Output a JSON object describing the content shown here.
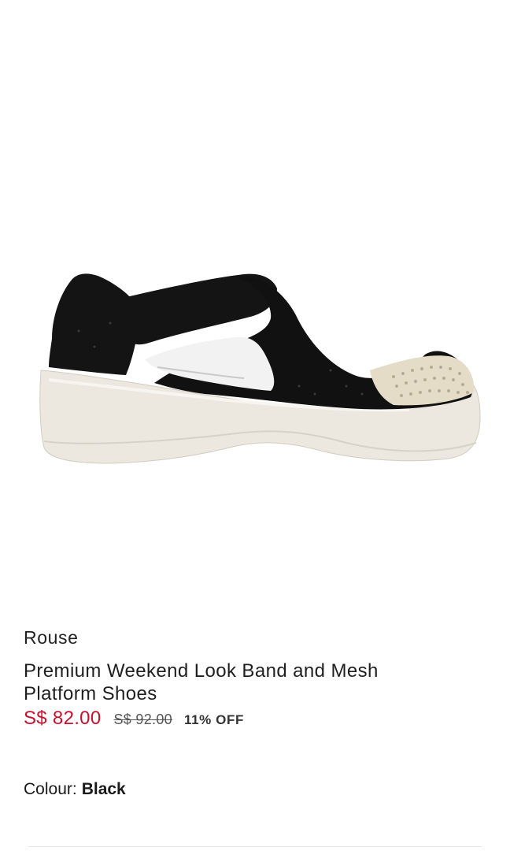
{
  "product": {
    "image_alt": "shoe-photo",
    "brand": "Rouse",
    "title_line1": "Premium Weekend Look Band and Mesh",
    "title_line2": "Platform Shoes",
    "price_current": "S$ 82.00",
    "price_original": "S$ 92.00",
    "discount": "11% OFF",
    "colour_label": "Colour:",
    "colour_value": "Black"
  },
  "colors": {
    "price_red": "#c8102e",
    "shoe_upper": "#121212",
    "shoe_sole": "#ece8df"
  }
}
